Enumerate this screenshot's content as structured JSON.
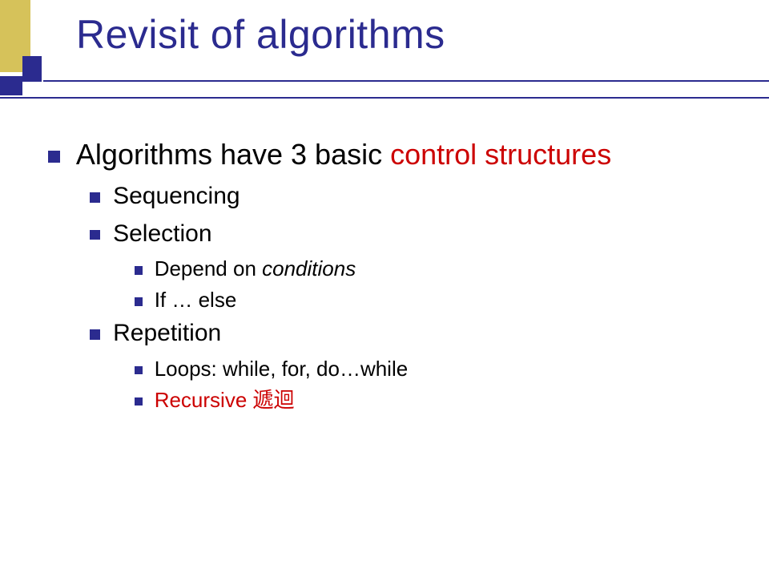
{
  "title": "Revisit of algorithms",
  "intro": {
    "prefix": "Algorithms have 3 basic ",
    "highlight": "control structures"
  },
  "items": {
    "sequencing": "Sequencing",
    "selection": "Selection",
    "selection_sub": {
      "depend_prefix": "Depend on ",
      "depend_italic": "conditions",
      "ifelse": "If … else"
    },
    "repetition": "Repetition",
    "repetition_sub": {
      "loops": "Loops: while, for, do…while",
      "recursive": "Recursive 遞迴"
    }
  },
  "colors": {
    "accent": "#cc0000",
    "brand": "#2b2b8f",
    "gold": "#d6c25a"
  }
}
